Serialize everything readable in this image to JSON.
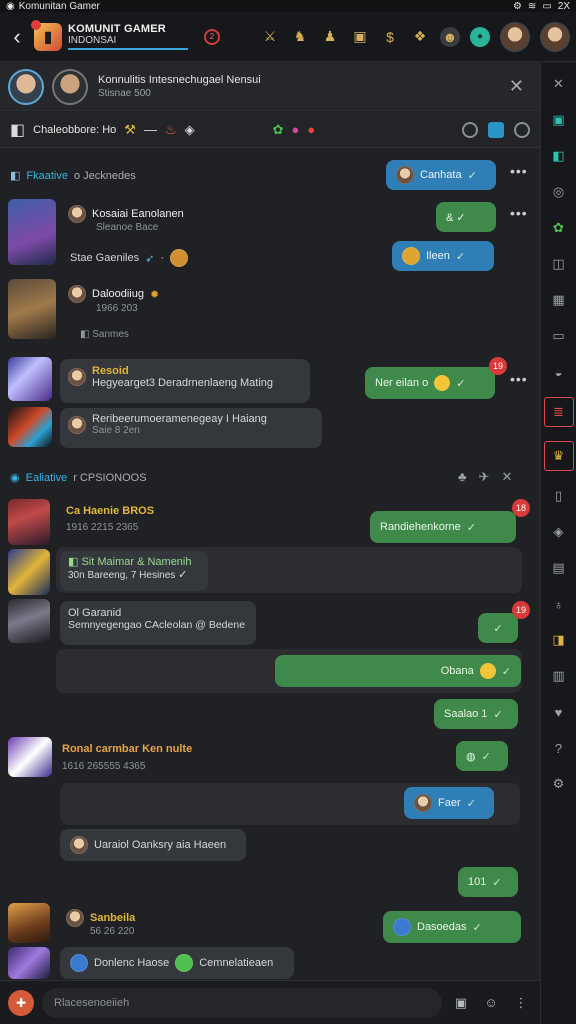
{
  "statusbar": {
    "app": "Komunitan Gamer",
    "right": "2X"
  },
  "topbar": {
    "title_line1": "KOMUNIT GAMER",
    "title_line2": "INDONSAI",
    "notif_count": "2",
    "icons": [
      "sword-icon",
      "unicorn-icon",
      "figure-icon",
      "chest-icon",
      "dollar-icon",
      "dragon-icon",
      "warrior-avatar",
      "status-dot",
      "avatar",
      "avatar"
    ]
  },
  "header2": {
    "line1": "Konnulitis Intesnechugael Nensui",
    "line2": "Stisnae 500",
    "close": "✕"
  },
  "toolbar": {
    "label": "Chaleobbore: Ho"
  },
  "sections": [
    {
      "prefix": "Fkaative",
      "rest": "o Jecknedes"
    },
    {
      "prefix": "Ealiative",
      "rest": "r CPSIONOOS"
    }
  ],
  "messages": {
    "out1": "Canhata",
    "m1_name": "Kosaiai Eanolanen",
    "m1_sub": "Sleanoe Bace",
    "m1_line": "Stae Gaeniles",
    "out2": "& ✓",
    "out3": "Ileen",
    "m2_name": "Daloodiiug",
    "m2_sub": "1966 203",
    "m2_sub2": "Sanmes",
    "m3_name": "Resoid",
    "m3_line": "Hegyearget3 Deradrnenlaeng Mating",
    "out4": "Ner eilan o",
    "out4_badge": "19",
    "m4_line1": "Reribeerumoeramenegeay I Haiang",
    "m4_line2": "Saie 8 2en",
    "m5_name": "Ca Haenie BROS",
    "m5_sub": "1916 2215 2365",
    "out5": "Randiehenkorne",
    "out5_badge": "18",
    "m6_name": "Sit Maimar & Namenih",
    "m6_sub": "30n Bareeng, 7 Hesines",
    "m7_name": "Ol Garanid",
    "m7_line": "Semnyegengao CAcleolan @ Bedene",
    "out6_badge": "19",
    "out7": "Obana",
    "out8": "Saalao 1",
    "m8_name": "Ronal carmbar Ken nulte",
    "m8_sub": "1616 265555 4365",
    "out9": "Faer",
    "m9_line": "Uaraiol Oanksry aia Haeen",
    "out10": "101",
    "m10_name": "Sanbeila",
    "m10_sub": "56 26 220",
    "out11": "Dasoedas",
    "m11_a": "Donlenc Haose",
    "m11_b": "Cemnelatieaen"
  },
  "composer": {
    "placeholder": "Rlacesenoeiieh"
  }
}
